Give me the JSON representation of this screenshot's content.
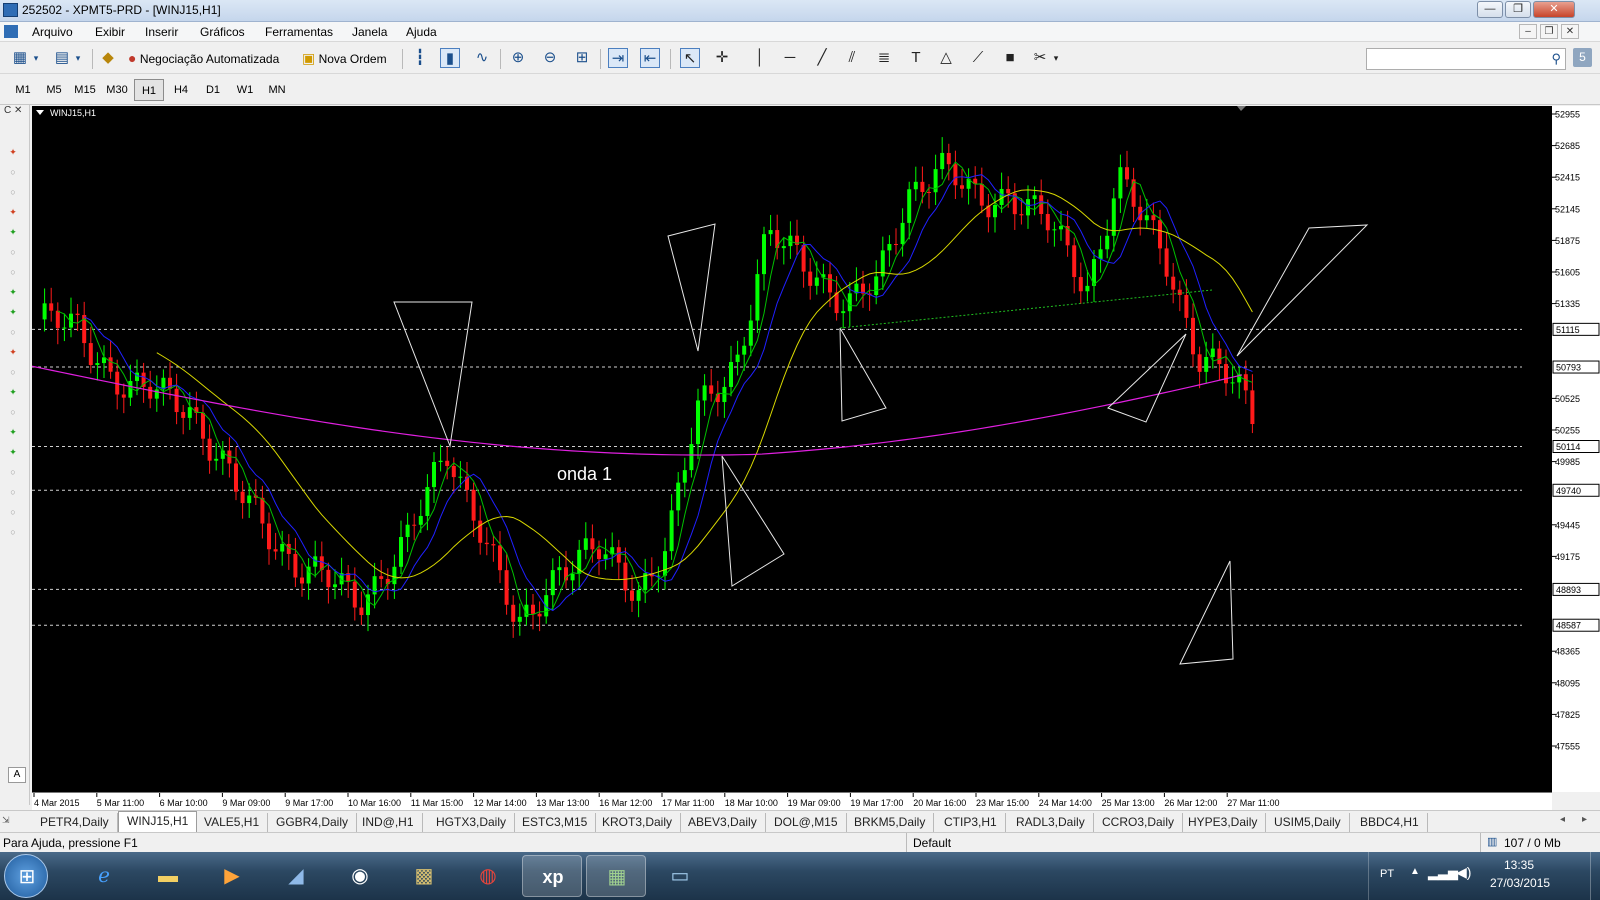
{
  "window": {
    "title": "252502 - XPMT5-PRD - [WINJ15,H1]"
  },
  "menu": [
    "Arquivo",
    "Exibir",
    "Inserir",
    "Gráficos",
    "Ferramentas",
    "Janela",
    "Ajuda"
  ],
  "toolbar": {
    "auto_trading": "Negociação Automatizada",
    "new_order": "Nova Ordem"
  },
  "timeframes": [
    "M1",
    "M5",
    "M15",
    "M30",
    "H1",
    "H4",
    "D1",
    "W1",
    "MN"
  ],
  "active_timeframe": "H1",
  "chart": {
    "label": "WINJ15,H1",
    "annotation": "onda 1",
    "price_ticks": [
      "52955",
      "52685",
      "52415",
      "52145",
      "51875",
      "51605",
      "51335",
      "50525",
      "50255",
      "49985",
      "49445",
      "49175",
      "48365",
      "48095",
      "47825",
      "47555"
    ],
    "level_labels": [
      "51115",
      "50793",
      "50114",
      "49740",
      "48893",
      "48587"
    ],
    "time_ticks": [
      "4 Mar 2015",
      "5 Mar 11:00",
      "6 Mar 10:00",
      "9 Mar 09:00",
      "9 Mar 17:00",
      "10 Mar 16:00",
      "11 Mar 15:00",
      "12 Mar 14:00",
      "13 Mar 13:00",
      "16 Mar 12:00",
      "17 Mar 11:00",
      "18 Mar 10:00",
      "19 Mar 09:00",
      "19 Mar 17:00",
      "20 Mar 16:00",
      "23 Mar 15:00",
      "24 Mar 14:00",
      "25 Mar 13:00",
      "26 Mar 12:00",
      "27 Mar 11:00"
    ],
    "colors": {
      "background": "#000000",
      "bull": "#00ff00",
      "bear": "#ff1a1a",
      "ma_fast": "#00c000",
      "ma_mid": "#2020ff",
      "ma_slow": "#d8d800",
      "ma_long": "#e020e0"
    }
  },
  "symbol_tabs": [
    "PETR4,Daily",
    "WINJ15,H1",
    "VALE5,H1",
    "GGBR4,Daily",
    "IND@,H1",
    "HGTX3,Daily",
    "ESTC3,M15",
    "KROT3,Daily",
    "ABEV3,Daily",
    "DOL@,M15",
    "BRKM5,Daily",
    "CTIP3,H1",
    "RADL3,Daily",
    "CCRO3,Daily",
    "HYPE3,Daily",
    "USIM5,Daily",
    "BBDC4,H1"
  ],
  "active_symbol_tab": "WINJ15,H1",
  "status": {
    "help": "Para Ajuda, pressione F1",
    "profile": "Default",
    "traffic": "107 / 0 Mb"
  },
  "taskbar": {
    "lang": "PT",
    "time": "13:35",
    "date": "27/03/2015"
  }
}
